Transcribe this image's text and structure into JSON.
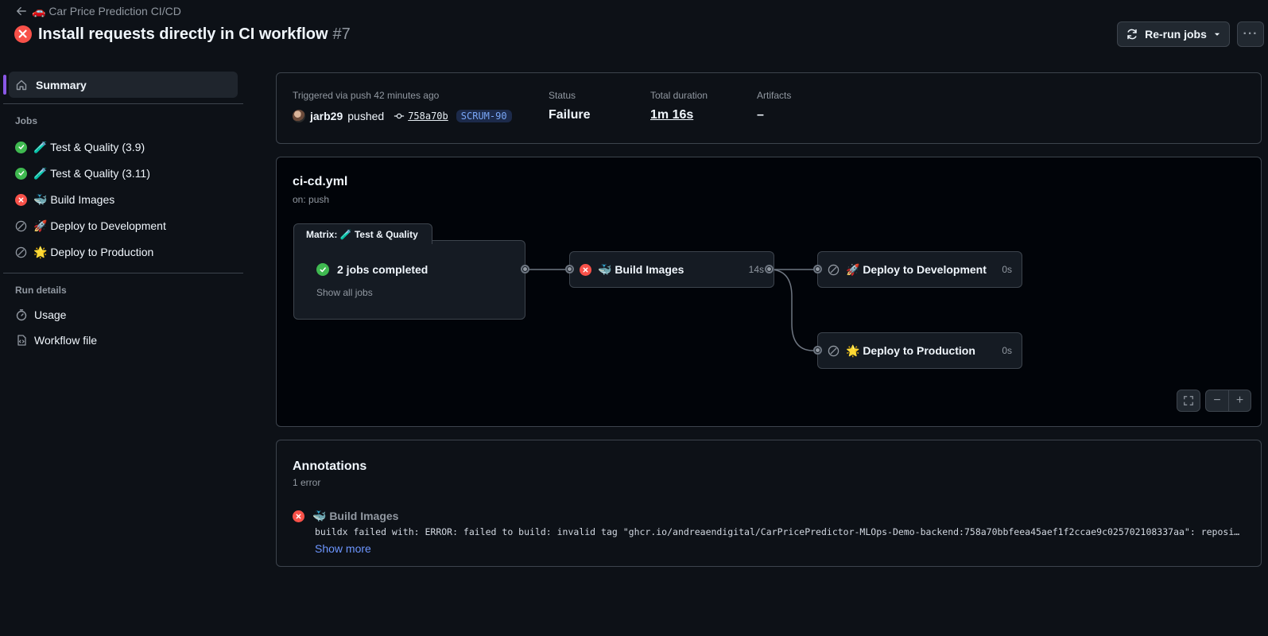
{
  "header": {
    "back_label": "🚗 Car Price Prediction CI/CD",
    "run_title": "Install requests directly in CI workflow",
    "run_number": "#7",
    "rerun_label": "Re-run jobs",
    "more_label": "···"
  },
  "sidebar": {
    "summary_label": "Summary",
    "jobs_heading": "Jobs",
    "jobs": [
      {
        "label": "🧪 Test & Quality (3.9)",
        "status": "success"
      },
      {
        "label": "🧪 Test & Quality (3.11)",
        "status": "success"
      },
      {
        "label": "🐳 Build Images",
        "status": "failure"
      },
      {
        "label": "🚀 Deploy to Development",
        "status": "skipped"
      },
      {
        "label": "🌟 Deploy to Production",
        "status": "skipped"
      }
    ],
    "run_details_heading": "Run details",
    "usage_label": "Usage",
    "workflow_file_label": "Workflow file"
  },
  "summary": {
    "trigger_label": "Triggered via push 42 minutes ago",
    "pusher": "jarb29",
    "pushed_word": "pushed",
    "commit_sha": "758a70b",
    "branch": "SCRUM-90",
    "status_label": "Status",
    "status_value": "Failure",
    "duration_label": "Total duration",
    "duration_value": "1m 16s",
    "artifacts_label": "Artifacts",
    "artifacts_value": "–"
  },
  "graph": {
    "file": "ci-cd.yml",
    "trigger": "on: push",
    "matrix_label": "Matrix: 🧪 Test & Quality",
    "matrix_status": "2 jobs completed",
    "matrix_show": "Show all jobs",
    "build": {
      "label": "🐳 Build Images",
      "duration": "14s"
    },
    "deploy_dev": {
      "label": "🚀 Deploy to Development",
      "duration": "0s"
    },
    "deploy_prod": {
      "label": "🌟 Deploy to Production",
      "duration": "0s"
    },
    "zoom_out": "−",
    "zoom_in": "+"
  },
  "annotations": {
    "title": "Annotations",
    "count": "1 error",
    "item_title": "🐳 Build Images",
    "message": "buildx failed with: ERROR: failed to build: invalid tag \"ghcr.io/andreaendigital/CarPricePredictor-MLOps-Demo-backend:758a70bbfeea45aef1f2ccae9c025702108337aa\": repository name must be lowercase",
    "show_more": "Show more"
  },
  "colors": {
    "background": "#0d1117",
    "failure": "#f85149",
    "success": "#3fb950",
    "accent": "#8957e5",
    "link": "#6d96ff"
  }
}
